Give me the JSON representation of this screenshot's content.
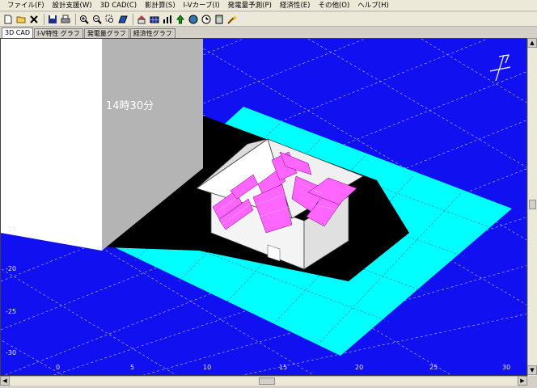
{
  "menu": [
    {
      "label": "ファイル(F)"
    },
    {
      "label": "設計支援(W)"
    },
    {
      "label": "3D CAD(C)"
    },
    {
      "label": "影計算(S)"
    },
    {
      "label": "I-Vカーブ(I)"
    },
    {
      "label": "発電量予測(P)"
    },
    {
      "label": "経済性(E)"
    },
    {
      "label": "その他(O)"
    },
    {
      "label": "ヘルプ(H)"
    }
  ],
  "toolbar": [
    "new-file-icon",
    "open-folder-icon",
    "close-icon",
    "save-icon",
    "print-icon",
    "zoom-in-icon",
    "zoom-out-icon",
    "zoom-window-icon",
    "panel-icon",
    "house-icon",
    "module-icon",
    "bar-chart-icon",
    "sun-arrow-icon",
    "globe-icon",
    "clock-icon",
    "calculator-icon",
    "wizard-icon"
  ],
  "tabs": [
    {
      "label": "3D CAD",
      "active": true
    },
    {
      "label": "I-V特性 グラフ",
      "active": false
    },
    {
      "label": "発電量グラフ",
      "active": false
    },
    {
      "label": "経済性グラフ",
      "active": false
    }
  ],
  "viewport": {
    "time_label": "14時30分",
    "y_axis_ticks": [
      "-15",
      "-20",
      "-25",
      "-30"
    ],
    "x_axis_ticks": [
      "0",
      "5",
      "10",
      "15",
      "20",
      "25",
      "30"
    ]
  },
  "colors": {
    "ground": "#1010f0",
    "mesh": "#00ffff",
    "shadow": "#000000",
    "panels": "#ff66ff",
    "building": "#c8c8c8"
  }
}
